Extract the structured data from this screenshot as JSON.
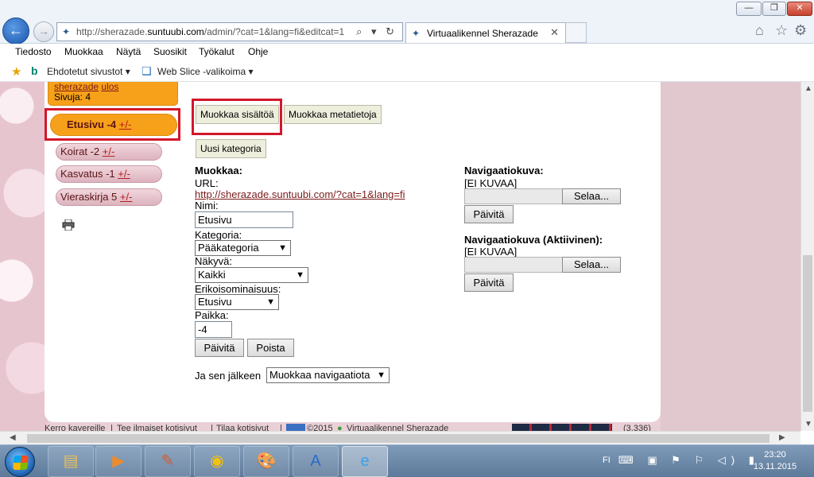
{
  "window": {
    "minimize": "—",
    "restore": "❐",
    "close": "✕"
  },
  "nav": {
    "back": "←",
    "forward": "→"
  },
  "address": {
    "url_prefix": "http://sherazade.",
    "url_domain": "suntuubi.com",
    "url_suffix": "/admin/?cat=1&lang=fi&editcat=1",
    "icons": "⌕ ▾ ↻"
  },
  "tab": {
    "title": "Virtuaalikennel Sherazade",
    "close": "✕"
  },
  "toolbar_icons": {
    "home": "⌂",
    "favorites": "☆",
    "tools": "⚙"
  },
  "menu": [
    "Tiedosto",
    "Muokkaa",
    "Näytä",
    "Suosikit",
    "Työkalut",
    "Ohje"
  ],
  "favorites_bar": {
    "suggested": "Ehdotetut sivustot ▾",
    "webslice": "Web Slice -valikoima ▾"
  },
  "sidebar": {
    "user": "sherazade",
    "logout": "ulos",
    "pages": "Sivuja: 4",
    "selected": {
      "name": "Etusivu -4 ",
      "pm": "+/-"
    },
    "items": [
      {
        "name": "Koirat -2 ",
        "pm": "+/-"
      },
      {
        "name": "Kasvatus -1 ",
        "pm": "+/-"
      },
      {
        "name": "Vieraskirja 5 ",
        "pm": "+/-"
      }
    ]
  },
  "main": {
    "edit_content": "Muokkaa sisältöä",
    "edit_meta": "Muokkaa metatietoja",
    "new_category": "Uusi kategoria",
    "edit_heading": "Muokkaa:",
    "url_label": "URL:",
    "url_value": "http://sherazade.suntuubi.com/?cat=1&lang=fi",
    "name_label": "Nimi:",
    "name_value": "Etusivu",
    "category_label": "Kategoria:",
    "category_value": "Pääkategoria",
    "visible_label": "Näkyvä:",
    "visible_value": "Kaikki",
    "special_label": "Erikoisominaisuus:",
    "special_value": "Etusivu",
    "place_label": "Paikka:",
    "place_value": "-4",
    "update": "Päivitä",
    "delete": "Poista",
    "after_label": "Ja sen jälkeen",
    "after_value": "Muokkaa navigaatiota",
    "nav_image_label": "Navigaatiokuva:",
    "no_image": "[EI KUVAA]",
    "browse": "Selaa...",
    "nav_image_active_label": "Navigaatiokuva (Aktiivinen):"
  },
  "footer": {
    "tell": "Kerro kavereille",
    "free": "Tee ilmaiset kotisivut",
    "order": "Tilaa kotisivut",
    "copyright": "©2015",
    "site": "Virtuaalikennel Sherazade",
    "count": "(3,336)"
  },
  "taskbar": {
    "lang": "FI",
    "tray_icons": "⌨ ▣ ⚑ ⚐ ◁) ▮",
    "time": "23:20",
    "date": "13.11.2015"
  }
}
